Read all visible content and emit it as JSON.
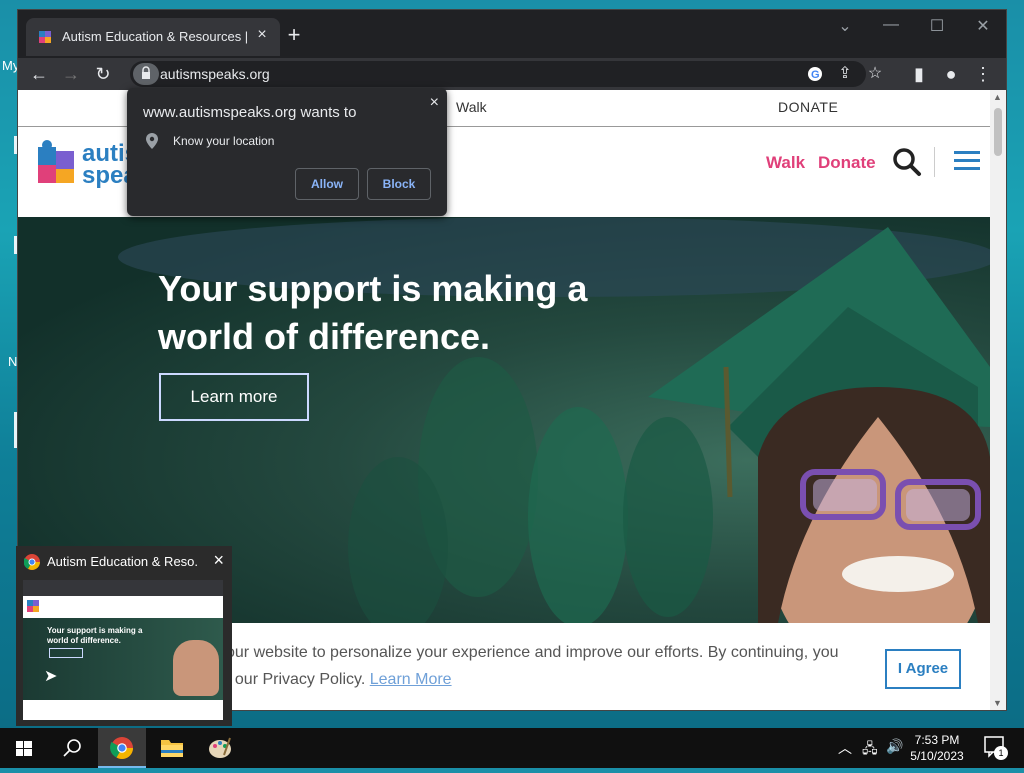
{
  "desktop": {
    "labels": [
      "My",
      "N"
    ]
  },
  "browser": {
    "tab_title": "Autism Education & Resources |",
    "tab_close": "×",
    "new_tab": "+",
    "url": "autismspeaks.org"
  },
  "popup": {
    "title": "www.autismspeaks.org wants to",
    "permission": "Know your location",
    "allow": "Allow",
    "block": "Block",
    "close": "×"
  },
  "site": {
    "topnav": {
      "walk": "Walk",
      "donate": "DONATE"
    },
    "logo_text": [
      "autis",
      "spea"
    ],
    "header": {
      "walk": "Walk",
      "donate": "Donate"
    },
    "hero": {
      "headline": "Your support is making a world of difference.",
      "cta": "Learn more"
    },
    "cookie": {
      "text": "our website to personalize your experience and improve our efforts. By continuing, you",
      "text2": "f our Privacy Policy.",
      "learn_more": "Learn More",
      "agree": "I Agree"
    }
  },
  "preview": {
    "title": "Autism Education & Reso...",
    "close": "×",
    "mini_headline": "Your support is making a world of difference."
  },
  "taskbar": {
    "time": "7:53 PM",
    "date": "5/10/2023",
    "notifications": "1"
  },
  "colors": {
    "brand_blue": "#2b7fc1",
    "brand_pink": "#e0407a",
    "chrome_dark": "#202124"
  }
}
